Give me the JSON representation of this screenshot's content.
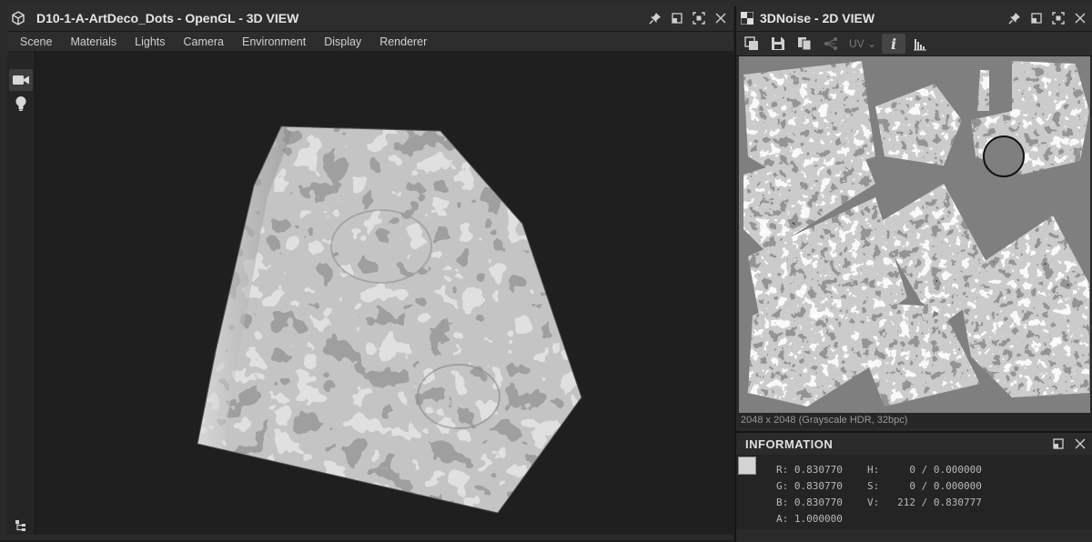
{
  "view3d": {
    "title": "D10-1-A-ArtDeco_Dots - OpenGL - 3D VIEW",
    "menu": [
      "Scene",
      "Materials",
      "Lights",
      "Camera",
      "Environment",
      "Display",
      "Renderer"
    ]
  },
  "view2d": {
    "title": "3DNoise - 2D VIEW",
    "uv_label": "UV",
    "status": "2048 x 2048 (Grayscale HDR, 32bpc)"
  },
  "info": {
    "title": "INFORMATION",
    "rgba": {
      "R": "R: 0.830770",
      "G": "G: 0.830770",
      "B": "B: 0.830770",
      "A": "A: 1.000000"
    },
    "hsv": {
      "H": "H:     0 / 0.000000",
      "S": "S:     0 / 0.000000",
      "V": "V:   212 / 0.830777"
    },
    "swatch_color": "#d4d4d4"
  },
  "icons": {
    "panel": [
      "cube-icon",
      "pin-icon",
      "restore-icon",
      "maximize-icon",
      "close-icon"
    ],
    "tools3d": [
      "camera-icon",
      "light-bulb-icon",
      "scene-tree-icon"
    ],
    "tools2d": [
      "copy-to-clipboard-icon",
      "save-icon",
      "duplicate-icon",
      "uv-graph-icon",
      "info-icon",
      "histogram-icon"
    ]
  }
}
